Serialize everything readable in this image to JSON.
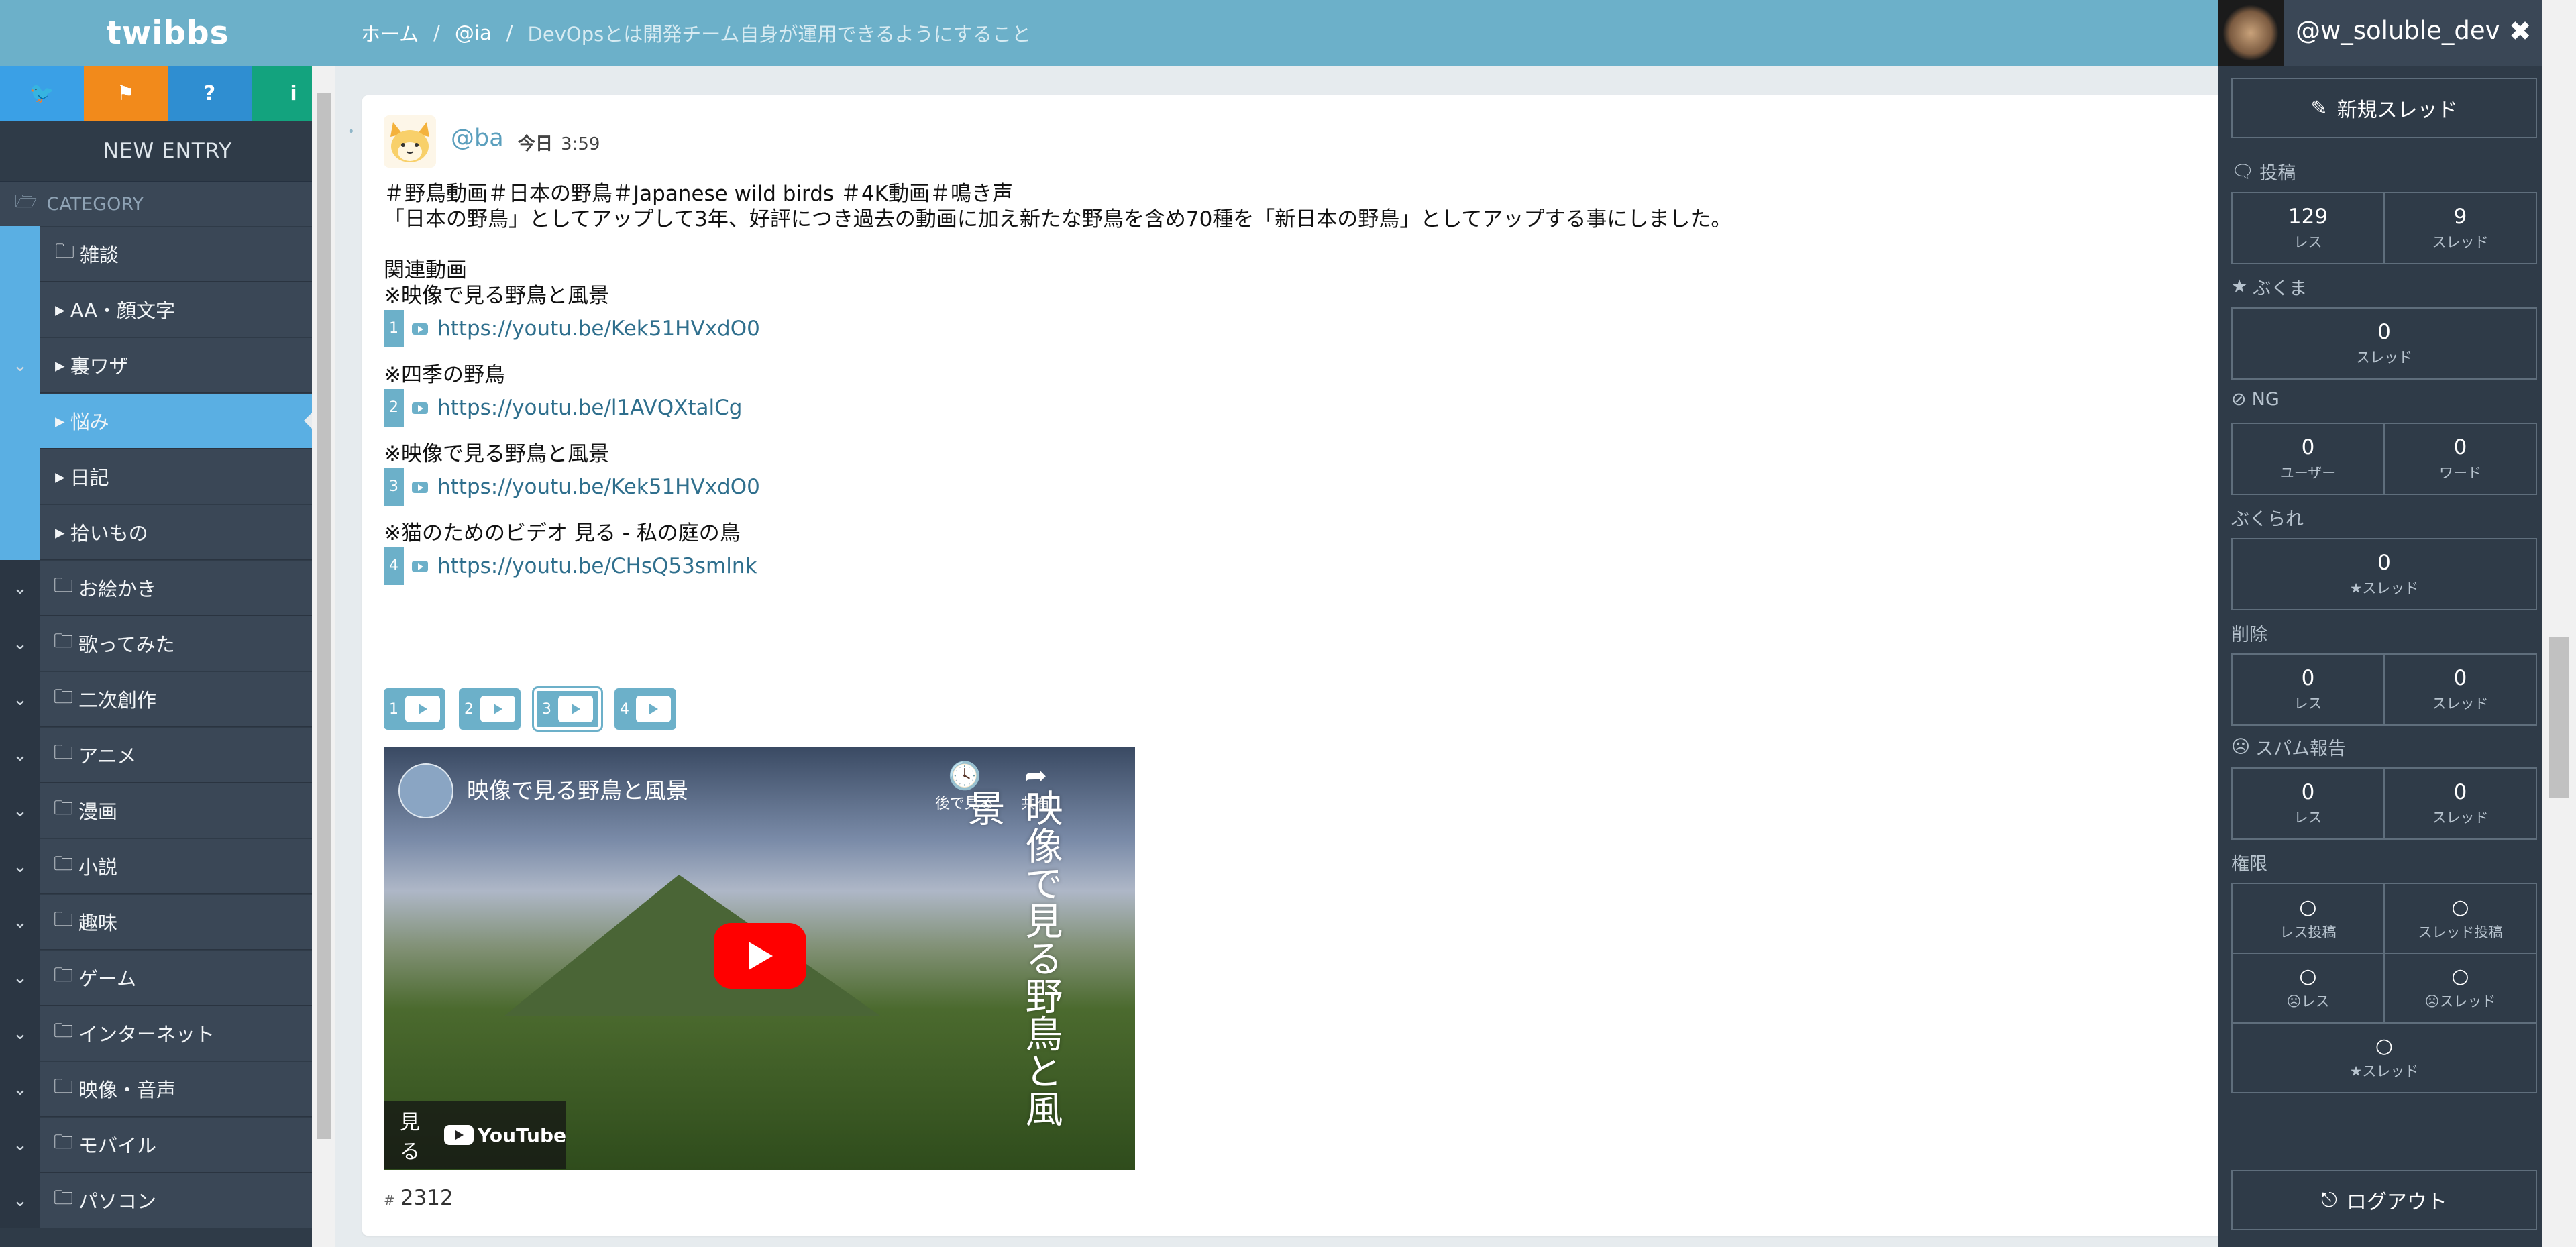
{
  "app": {
    "logo": "twibbs"
  },
  "breadcrumb": {
    "home": "ホーム",
    "board": "@ia",
    "current": "DevOpsとは開発チーム自身が運用できるようにすること",
    "sep": "/"
  },
  "sidebar": {
    "icon_buttons": [
      {
        "icon": "twitter-icon",
        "glyph": "🐦",
        "color": "#3aa0e6"
      },
      {
        "icon": "flag-icon",
        "glyph": "⚑",
        "color": "#f28a1b"
      },
      {
        "icon": "help-icon",
        "glyph": "?",
        "color": "#2f8ed1"
      },
      {
        "icon": "info-icon",
        "glyph": "i",
        "color": "#13a37e"
      }
    ],
    "new_entry": "NEW ENTRY",
    "category_header": "CATEGORY",
    "parent": {
      "label": "雑談"
    },
    "subitems": [
      {
        "label": "AA・顔文字"
      },
      {
        "label": "裏ワザ"
      },
      {
        "label": "悩み",
        "active": true
      },
      {
        "label": "日記"
      },
      {
        "label": "拾いもの"
      }
    ],
    "categories": [
      {
        "label": "お絵かき"
      },
      {
        "label": "歌ってみた"
      },
      {
        "label": "二次創作"
      },
      {
        "label": "アニメ"
      },
      {
        "label": "漫画"
      },
      {
        "label": "小説"
      },
      {
        "label": "趣味"
      },
      {
        "label": "ゲーム"
      },
      {
        "label": "インターネット"
      },
      {
        "label": "映像・音声"
      },
      {
        "label": "モバイル"
      },
      {
        "label": "パソコン"
      }
    ]
  },
  "post": {
    "author": "@ba",
    "date_label": "今日",
    "time": "3:59",
    "hashtags": "＃野鳥動画＃日本の野鳥＃Japanese wild birds ＃4K動画＃鳴き声",
    "intro": "「日本の野鳥」としてアップして3年、好評につき過去の動画に加え新たな野鳥を含め70種を「新日本の野鳥」としてアップする事にしました。",
    "related_heading": "関連動画",
    "links": [
      {
        "title": "※映像で見る野鳥と風景",
        "num": "1",
        "url": "https://youtu.be/Kek51HVxdO0"
      },
      {
        "title": "※四季の野鳥",
        "num": "2",
        "url": "https://youtu.be/l1AVQXtalCg"
      },
      {
        "title": "※映像で見る野鳥と風景",
        "num": "3",
        "url": "https://youtu.be/Kek51HVxdO0"
      },
      {
        "title": "※猫のためのビデオ 見る - 私の庭の鳥",
        "num": "4",
        "url": "https://youtu.be/CHsQ53smlnk"
      }
    ],
    "video_tabs": [
      "1",
      "2",
      "3",
      "4"
    ],
    "selected_tab": "3",
    "video": {
      "title": "映像で見る野鳥と風景",
      "watch_later": "後で見る",
      "share": "共有",
      "overlay_text": "映像で見る野鳥と風景",
      "watch_on": "見る",
      "brand": "YouTube"
    },
    "post_number_prefix": "#",
    "post_number": "2312"
  },
  "user_panel": {
    "username": "@w_soluble_dev",
    "new_thread": "新規スレッド",
    "sections": {
      "posts": {
        "title": "投稿",
        "res": "129",
        "res_label": "レス",
        "threads": "9",
        "threads_label": "スレッド"
      },
      "bookmarks": {
        "title": "ぶくま",
        "threads": "0",
        "threads_label": "スレッド"
      },
      "ng": {
        "title": "NG",
        "users": "0",
        "users_label": "ユーザー",
        "words": "0",
        "words_label": "ワード"
      },
      "bukurare": {
        "title": "ぶくられ",
        "threads": "0",
        "threads_label": "★スレッド"
      },
      "deleted": {
        "title": "削除",
        "res": "0",
        "res_label": "レス",
        "threads": "0",
        "threads_label": "スレッド"
      },
      "spam": {
        "title": "スパム報告",
        "res": "0",
        "res_label": "レス",
        "threads": "0",
        "threads_label": "スレッド"
      },
      "perms": {
        "title": "権限",
        "mark": "○",
        "res_post": "レス投稿",
        "thread_post": "スレッド投稿",
        "anon_res": "☹レス",
        "anon_thread": "☹スレッド",
        "star_thread": "★スレッド"
      }
    },
    "logout": "ログアウト"
  },
  "colors": {
    "topbar": "#6cb0c9",
    "sidebar": "#2f3b48",
    "accent": "#5aafe3",
    "link": "#2f6f8d"
  }
}
